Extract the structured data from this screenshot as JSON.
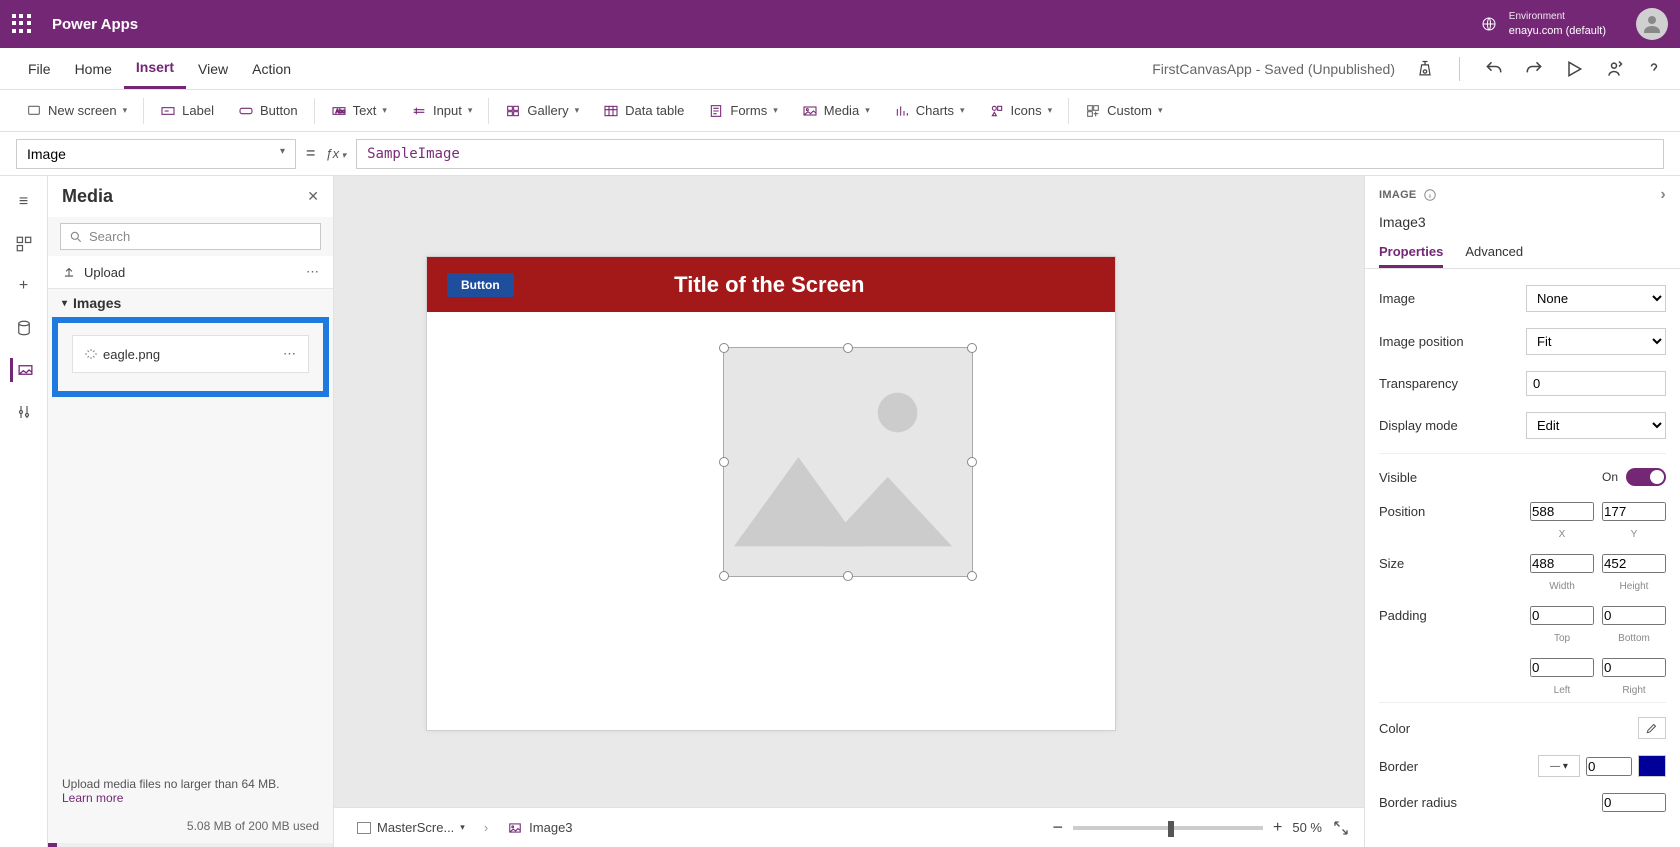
{
  "header": {
    "app_name": "Power Apps",
    "env_label": "Environment",
    "env_name": "enayu.com (default)"
  },
  "menubar": {
    "items": [
      "File",
      "Home",
      "Insert",
      "View",
      "Action"
    ],
    "active_index": 2,
    "status": "FirstCanvasApp - Saved (Unpublished)"
  },
  "ribbon": {
    "new_screen": "New screen",
    "label": "Label",
    "button": "Button",
    "text": "Text",
    "input": "Input",
    "gallery": "Gallery",
    "data_table": "Data table",
    "forms": "Forms",
    "media": "Media",
    "charts": "Charts",
    "icons": "Icons",
    "custom": "Custom"
  },
  "formula": {
    "property": "Image",
    "value": "SampleImage"
  },
  "left_panel": {
    "title": "Media",
    "search_placeholder": "Search",
    "upload": "Upload",
    "group": "Images",
    "file": "eagle.png",
    "footer_text": "Upload media files no larger than 64 MB.",
    "learn_more": "Learn more",
    "storage": "5.08 MB of 200 MB used"
  },
  "canvas": {
    "button": "Button",
    "title": "Title of the Screen"
  },
  "bottom": {
    "screen": "MasterScre...",
    "control": "Image3",
    "zoom": "50 %"
  },
  "right_panel": {
    "head": "IMAGE",
    "name": "Image3",
    "tabs": [
      "Properties",
      "Advanced"
    ],
    "image_lbl": "Image",
    "image_val": "None",
    "imgpos_lbl": "Image position",
    "imgpos_val": "Fit",
    "trans_lbl": "Transparency",
    "trans_val": "0",
    "disp_lbl": "Display mode",
    "disp_val": "Edit",
    "visible_lbl": "Visible",
    "visible_on": "On",
    "pos_lbl": "Position",
    "pos_x": "588",
    "pos_y": "177",
    "x_lbl": "X",
    "y_lbl": "Y",
    "size_lbl": "Size",
    "size_w": "488",
    "size_h": "452",
    "w_lbl": "Width",
    "h_lbl": "Height",
    "pad_lbl": "Padding",
    "pad_t": "0",
    "pad_b": "0",
    "pad_l": "0",
    "pad_r": "0",
    "t_lbl": "Top",
    "b_lbl": "Bottom",
    "l_lbl": "Left",
    "r_lbl": "Right",
    "color_lbl": "Color",
    "border_lbl": "Border",
    "border_w": "0",
    "radius_lbl": "Border radius",
    "radius_v": "0"
  }
}
